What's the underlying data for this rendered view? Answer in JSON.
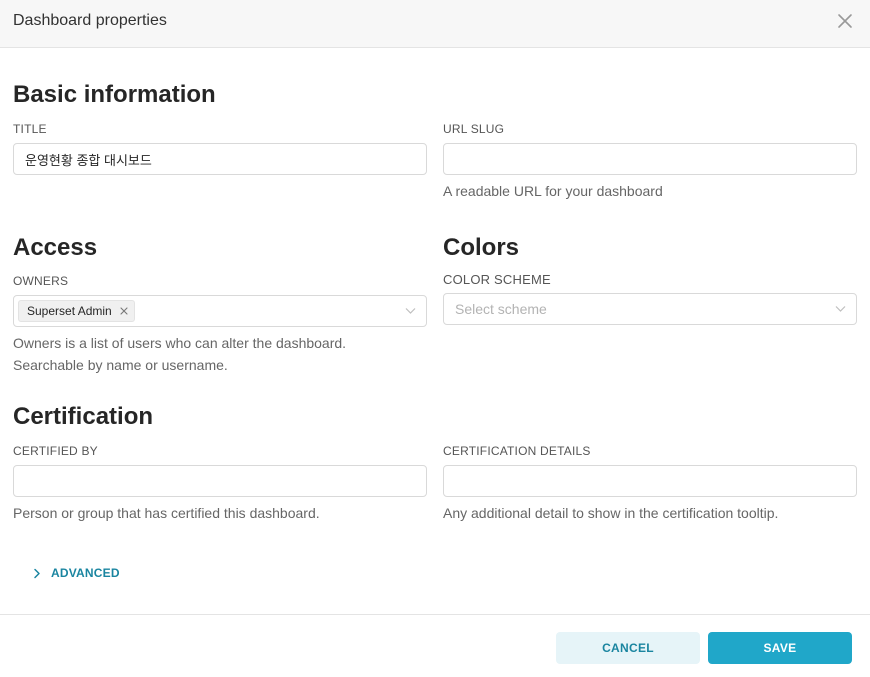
{
  "modal": {
    "title": "Dashboard properties"
  },
  "basic": {
    "section_title": "Basic information",
    "title_label": "TITLE",
    "title_value": "운영현황 종합 대시보드",
    "slug_label": "URL SLUG",
    "slug_value": "",
    "slug_help": "A readable URL for your dashboard"
  },
  "access": {
    "section_title": "Access",
    "owners_label": "OWNERS",
    "owners": [
      "Superset Admin"
    ],
    "owners_help_line1": "Owners is a list of users who can alter the dashboard.",
    "owners_help_line2": "Searchable by name or username."
  },
  "colors": {
    "section_title": "Colors",
    "scheme_label": "COLOR SCHEME",
    "scheme_placeholder": "Select scheme"
  },
  "certification": {
    "section_title": "Certification",
    "certified_by_label": "CERTIFIED BY",
    "certified_by_value": "",
    "certified_by_help": "Person or group that has certified this dashboard.",
    "details_label": "CERTIFICATION DETAILS",
    "details_value": "",
    "details_help": "Any additional detail to show in the certification tooltip."
  },
  "advanced": {
    "label": "ADVANCED"
  },
  "footer": {
    "cancel_label": "CANCEL",
    "save_label": "SAVE"
  },
  "colors_theme": {
    "primary": "#20a7c9",
    "primary_text": "#1a85a0",
    "cancel_bg": "#e6f4f8"
  }
}
